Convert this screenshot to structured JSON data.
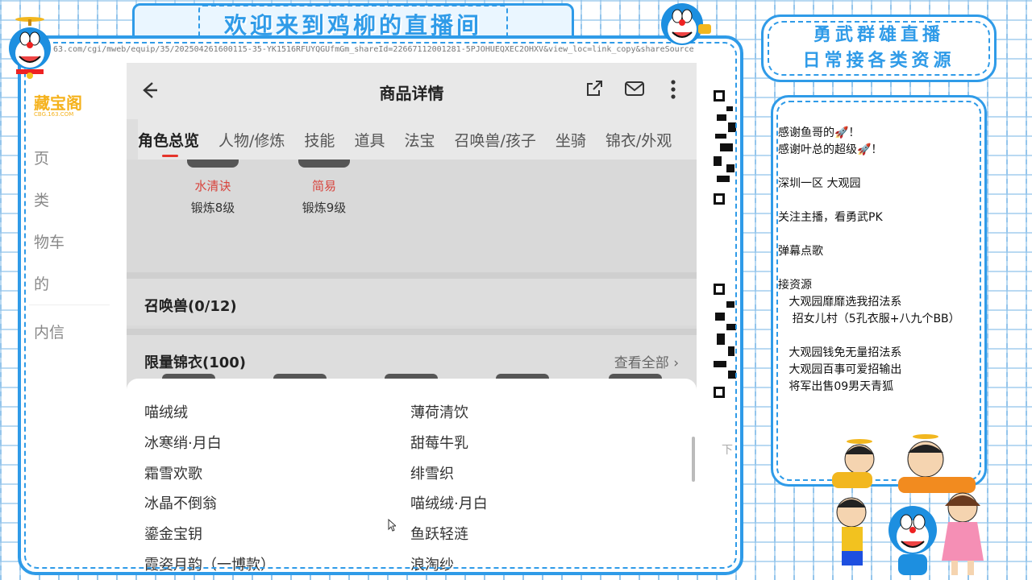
{
  "banner": {
    "title": "欢迎来到鸡柳的直播间",
    "right_line1": "勇武群雄直播",
    "right_line2": "日常接各类资源"
  },
  "browser": {
    "url": "63.com/cgi/mweb/equip/35/202504261600115-35-YK1516RFUYQGUfmGm_shareId=22667112001281-5PJOHUEQXEC2OHXV&view_loc=link_copy&shareSource"
  },
  "left_page": {
    "logo": "藏宝阁",
    "logo_sub": "CBG.163.COM",
    "nav": [
      "页",
      "类",
      "物车",
      "的",
      "内信"
    ]
  },
  "app": {
    "title": "商品详情",
    "back_icon": "arrow-left-icon",
    "share_icon": "share-icon",
    "mail_icon": "mail-icon",
    "more_icon": "more-vertical-icon",
    "tabs": [
      "角色总览",
      "人物/修炼",
      "技能",
      "道具",
      "法宝",
      "召唤兽/孩子",
      "坐骑",
      "锦衣/外观"
    ],
    "active_tab": 0,
    "skills": [
      {
        "name": "水清诀",
        "level": "锻炼8级"
      },
      {
        "name": "简易",
        "level": "锻炼9级"
      }
    ],
    "summon_section": "召唤兽(0/12)",
    "costume_section": "限量锦衣(100)",
    "view_all": "查看全部",
    "list_left": [
      "喵绒绒",
      "冰寒绡·月白",
      "霜雪欢歌",
      "冰晶不倒翁",
      "鎏金宝钥",
      "霞姿月韵（一博款）"
    ],
    "list_right": [
      "薄荷清饮",
      "甜莓牛乳",
      "绯雪织",
      "喵绒绒·月白",
      "鱼跃轻涟",
      "浪淘纱"
    ]
  },
  "info_panel": {
    "lines": [
      "感谢鱼哥的🚀！",
      "感谢叶总的超级🚀！",
      "",
      "深圳一区 大观园",
      "",
      "关注主播，看勇武PK",
      "",
      "弹幕点歌",
      "",
      "接资源",
      "   大观园靡靡选我招法系",
      "    招女儿村（5孔衣服+八九个BB）",
      "",
      "   大观园钱免无量招法系",
      "   大观园百事可爱招输出",
      "   将军出售09男天青狐"
    ]
  },
  "qr_caption": "下",
  "colors": {
    "frame_blue": "#2f9be8",
    "accent_red": "#e5352b",
    "logo_gold": "#f5b21c"
  }
}
